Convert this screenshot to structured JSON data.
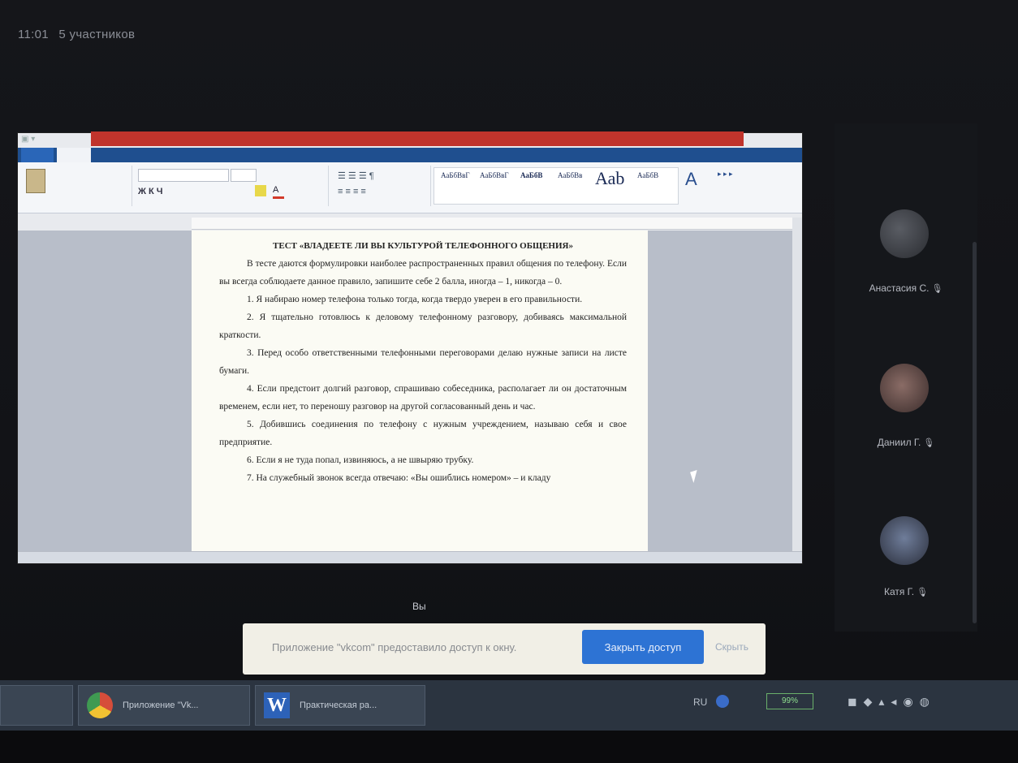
{
  "topbar": {
    "time": "11:01",
    "participants": "5 участников"
  },
  "word": {
    "styles": [
      "АаБбВвГ",
      "АаБбВвГ",
      "АаБбВ",
      "АаБбВв",
      "Ааb",
      "АаБбВ"
    ],
    "document": {
      "heading": "ТЕСТ «ВЛАДЕЕТЕ ЛИ ВЫ КУЛЬТУРОЙ ТЕЛЕФОННОГО ОБЩЕНИЯ»",
      "paragraphs": [
        "В тесте даются формулировки наиболее распространенных правил общения по телефону. Если вы всегда соблюдаете данное правило, запишите себе 2 балла, иногда – 1, никогда – 0.",
        "1. Я набираю номер телефона только тогда, когда твердо уверен в его правильности.",
        "2. Я тщательно готовлюсь к деловому телефонному разговору, добиваясь максимальной краткости.",
        "3. Перед особо ответственными телефонными переговорами делаю нужные записи на листе бумаги.",
        "4. Если предстоит долгий разговор, спрашиваю собеседника, располагает ли он достаточным временем, если нет, то переношу разговор на другой согласованный день и час.",
        "5. Добившись соединения по телефону с нужным учреждением, называю себя и свое предприятие.",
        "6. Если я не туда попал, извиняюсь, а не швыряю трубку.",
        "7. На служебный звонок всегда отвечаю: «Вы ошиблись номером» – и кладу"
      ]
    }
  },
  "participants": [
    {
      "name": "Анастасия С."
    },
    {
      "name": "Даниил Г."
    },
    {
      "name": "Катя Г."
    }
  ],
  "self_label": "Вы",
  "share_banner": {
    "message": "Приложение \"vkcom\" предоставило доступ к окну.",
    "stop_button": "Закрыть доступ",
    "hide_link": "Скрыть"
  },
  "taskbar": {
    "tasks": [
      {
        "label": "Приложение \"Vk..."
      },
      {
        "label": "Практическая ра..."
      }
    ],
    "lang": "RU",
    "battery": "99%"
  },
  "colors": {
    "accent": "#2d73d4",
    "title_bar": "#c0342c",
    "panel": "#15171b"
  }
}
